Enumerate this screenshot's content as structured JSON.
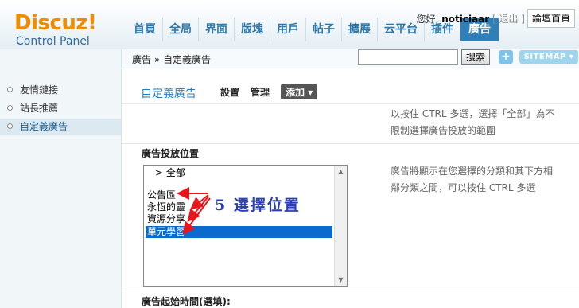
{
  "logo": {
    "brand": "Discuz!",
    "sub": "Control Panel"
  },
  "user": {
    "greeting": "您好,",
    "name": "noticiaar",
    "bracket_text": "[ 退出 ]"
  },
  "forum_home": "論壇首頁",
  "nav": [
    "首頁",
    "全局",
    "界面",
    "版塊",
    "用戶",
    "帖子",
    "擴展",
    "云平台",
    "插件",
    "廣告"
  ],
  "nav_active_index": 9,
  "search": {
    "button": "搜索",
    "plus": "+",
    "sitemap": "SITEMAP ▾"
  },
  "breadcrumb": "廣告 » 自定義廣告",
  "sidebar": {
    "items": [
      {
        "label": "友情鏈接",
        "active": false
      },
      {
        "label": "站長推薦",
        "active": false
      },
      {
        "label": "自定義廣告",
        "active": true
      }
    ]
  },
  "main": {
    "title": "自定義廣告",
    "tabs": {
      "settings": "設置",
      "manage": "管理",
      "add": "添加 ▾"
    },
    "top_hint_line1": "以按住 CTRL 多選，選擇「全部」為不",
    "top_hint_line2": "限制選擇廣告投放的範圍",
    "placement_label": "廣告投放位置",
    "list_options": [
      "> 全部",
      "",
      "公告區",
      "永恆的靈",
      "資源分享",
      "單元學習"
    ],
    "selected_option": "單元學習",
    "side_hint_line1": "廣告將顯示在您選擇的分類和其下方相",
    "side_hint_line2": "鄰分類之間，可以按住 CTRL 多選",
    "start_time_label": "廣告起始時間(選填):"
  },
  "annotation": {
    "text": "5 選擇位置",
    "color": "#2c3fb0",
    "arrow_color": "#e8161b"
  },
  "colors": {
    "accent": "#2f80b8",
    "nav_text": "#2f77a8",
    "logo": "#f08c00",
    "selection": "#0a6acd"
  }
}
